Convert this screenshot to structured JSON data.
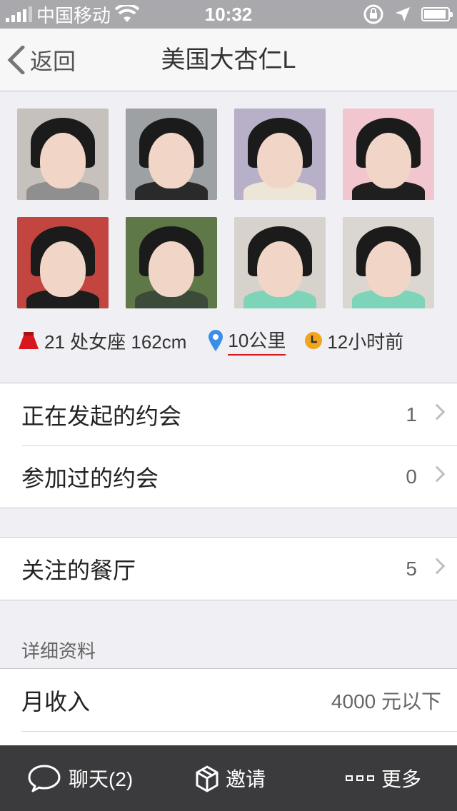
{
  "status_bar": {
    "carrier": "中国移动",
    "time": "10:32"
  },
  "nav": {
    "back_label": "返回",
    "title": "美国大杏仁L"
  },
  "photos": [
    {
      "bg": "#c7c1bd",
      "body": "#8f8f8f"
    },
    {
      "bg": "#9da1a4",
      "body": "#2a2a2a"
    },
    {
      "bg": "#b7b0c8",
      "body": "#ede6d6"
    },
    {
      "bg": "#f2c6cf",
      "body": "#1f1f1f"
    },
    {
      "bg": "#c2463f",
      "body": "#1d1d1d"
    },
    {
      "bg": "#5f7848",
      "body": "#3c4a3a"
    },
    {
      "bg": "#d8d2cc",
      "body": "#7ed4b8"
    },
    {
      "bg": "#dcd6d0",
      "body": "#7ed4b8"
    }
  ],
  "info": {
    "profile": "21 处女座 162cm",
    "distance": "10公里",
    "last_active": "12小时前"
  },
  "dates_group": [
    {
      "label": "正在发起的约会",
      "value": "1"
    },
    {
      "label": "参加过的约会",
      "value": "0"
    }
  ],
  "restaurants": {
    "label": "关注的餐厅",
    "value": "5"
  },
  "details": {
    "header": "详细资料",
    "rows": [
      {
        "label": "月收入",
        "value": "4000 元以下"
      }
    ]
  },
  "tab_bar": {
    "chat_label": "聊天(2)",
    "invite_label": "邀请",
    "more_label": "更多"
  },
  "colors": {
    "accent_red": "#d7171c",
    "pin_blue": "#3b8ee8",
    "clock_orange": "#f0a51c",
    "skirt_red": "#d7171c"
  }
}
